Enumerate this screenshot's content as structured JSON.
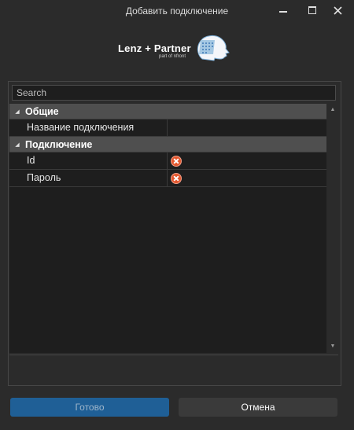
{
  "window": {
    "title": "Добавить подключение",
    "controls": [
      "minimize-icon",
      "maximize-icon",
      "close-icon"
    ]
  },
  "logo": {
    "text": "Lenz + Partner",
    "subtext": "part of nfront"
  },
  "search": {
    "placeholder": "Search",
    "value": ""
  },
  "grid": {
    "categories": [
      {
        "label": "Общие",
        "expanded": true,
        "rows": [
          {
            "name": "Название подключения",
            "value": "",
            "error": false
          }
        ]
      },
      {
        "label": "Подключение",
        "expanded": true,
        "rows": [
          {
            "name": "Id",
            "value": "",
            "error": true
          },
          {
            "name": "Пароль",
            "value": "",
            "error": true
          }
        ]
      }
    ]
  },
  "buttons": {
    "ok": "Готово",
    "cancel": "Отмена"
  },
  "colors": {
    "background": "#2b2b2b",
    "grid_background": "#1e1e1e",
    "category_header": "#4f4f4f",
    "primary_button": "#1f5f96",
    "secondary_button": "#3a3a3a",
    "error": "#e3572e"
  }
}
